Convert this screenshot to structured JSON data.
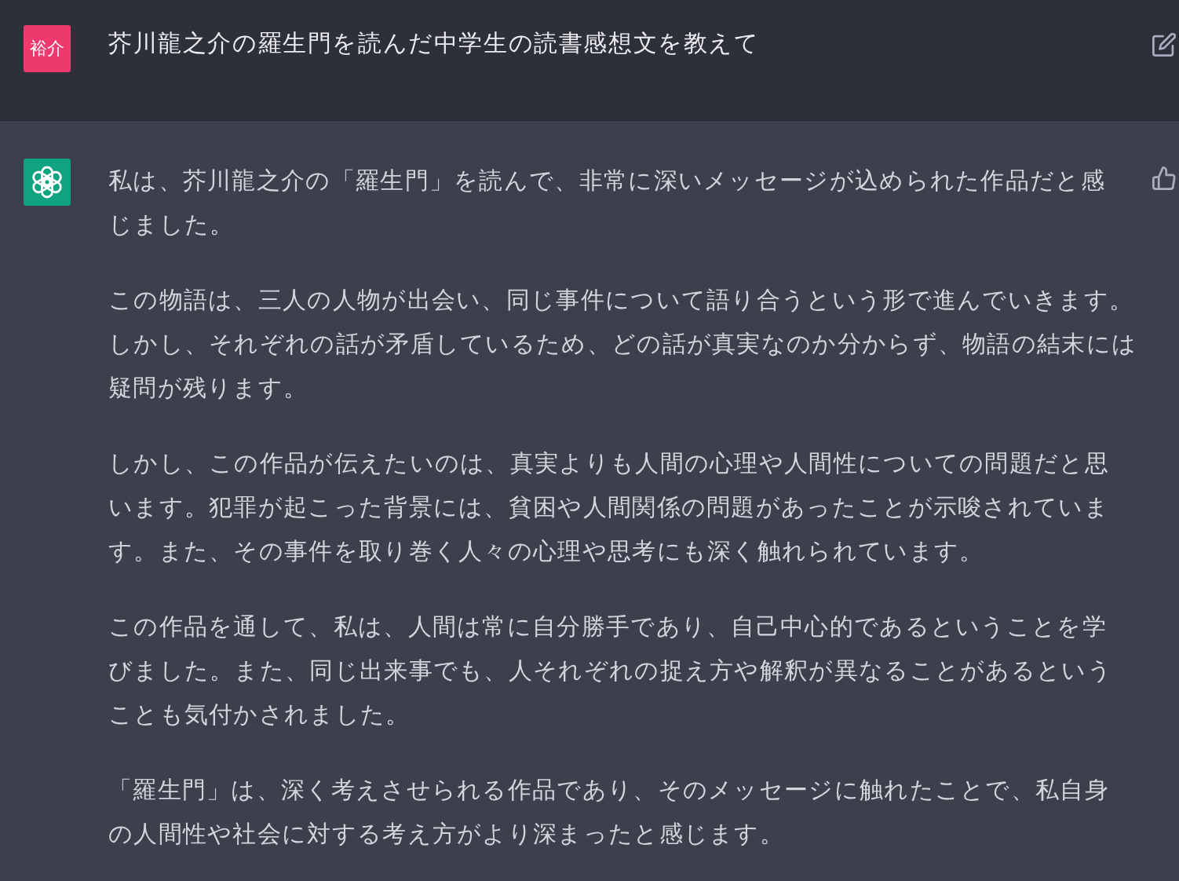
{
  "messages": [
    {
      "kind": "user",
      "avatar_label": "裕介",
      "paragraphs": [
        {
          "lines": [
            "芥川龍之介の羅生門を読んだ中学生の読書感想文を教えて"
          ]
        }
      ]
    },
    {
      "kind": "assistant",
      "paragraphs": [
        {
          "lines": [
            "私は、芥川龍之介の「羅生門」を読んで、非常に深いメッセージが込められた作品だと感",
            "じました。"
          ]
        },
        {
          "lines": [
            "この物語は、三人の人物が出会い、同じ事件について語り合うという形で進んでいきます。",
            "しかし、それぞれの話が矛盾しているため、どの話が真実なのか分からず、物語の結末には",
            "疑問が残ります。"
          ]
        },
        {
          "lines": [
            "しかし、この作品が伝えたいのは、真実よりも人間の心理や人間性についての問題だと思",
            "います。犯罪が起こった背景には、貧困や人間関係の問題があったことが示唆されていま",
            "す。また、その事件を取り巻く人々の心理や思考にも深く触れられています。"
          ]
        },
        {
          "lines": [
            "この作品を通して、私は、人間は常に自分勝手であり、自己中心的であるということを学",
            "びました。また、同じ出来事でも、人それぞれの捉え方や解釈が異なることがあるという",
            "ことも気付かされました。"
          ]
        },
        {
          "lines": [
            "「羅生門」は、深く考えさせられる作品であり、そのメッセージに触れたことで、私自身",
            "の人間性や社会に対する考え方がより深まったと感じます。"
          ]
        }
      ]
    }
  ]
}
